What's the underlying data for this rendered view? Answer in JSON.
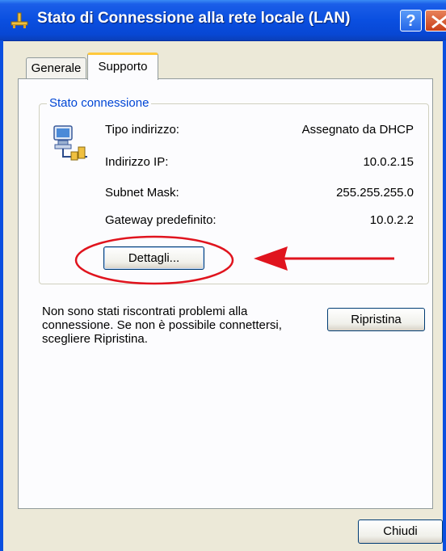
{
  "window": {
    "title": "Stato di Connessione alla rete locale (LAN)",
    "help_label": "?",
    "colors": {
      "titlebar": "#0a4fe0",
      "accent_tab": "#ffc83c",
      "group_title": "#0046d5",
      "annotation": "#e0141e"
    }
  },
  "tabs": [
    {
      "label": "Generale",
      "selected": false
    },
    {
      "label": "Supporto",
      "selected": true
    }
  ],
  "connection_status": {
    "group_title": "Stato connessione",
    "icon": "network-connection-icon",
    "rows": [
      {
        "label": "Tipo indirizzo:",
        "value": "Assegnato da DHCP"
      },
      {
        "label": "Indirizzo IP:",
        "value": "10.0.2.15"
      },
      {
        "label": "Subnet Mask:",
        "value": "255.255.255.0"
      },
      {
        "label": "Gateway predefinito:",
        "value": "10.0.2.2"
      }
    ],
    "details_button": "Dettagli..."
  },
  "message": "Non sono stati riscontrati problemi alla connessione. Se non è possibile connettersi, scegliere Ripristina.",
  "repair_button": "Ripristina",
  "close_button": "Chiudi"
}
